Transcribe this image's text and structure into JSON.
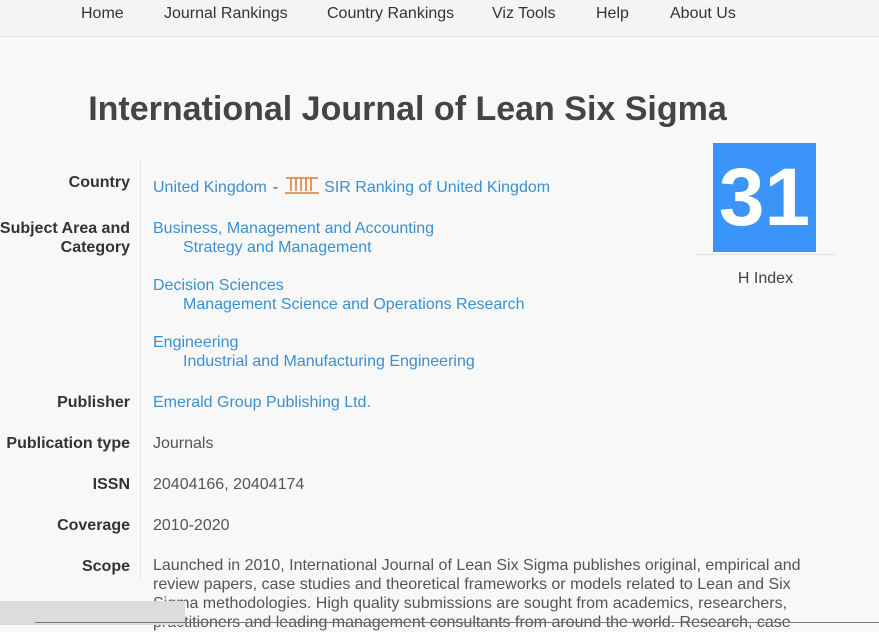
{
  "nav": {
    "items": [
      {
        "label": "Home"
      },
      {
        "label": "Journal Rankings"
      },
      {
        "label": "Country Rankings"
      },
      {
        "label": "Viz Tools"
      },
      {
        "label": "Help"
      },
      {
        "label": "About Us"
      }
    ]
  },
  "journal": {
    "title": "International Journal of Lean Six Sigma"
  },
  "country": {
    "label": "Country",
    "value": "United Kingdom",
    "separator": "-",
    "sir_link": "SIR Ranking of United Kingdom"
  },
  "subject": {
    "label_line1": "Subject Area and",
    "label_line2": "Category",
    "areas": [
      {
        "area": "Business, Management and Accounting",
        "category": "Strategy and Management"
      },
      {
        "area": "Decision Sciences",
        "category": "Management Science and Operations Research"
      },
      {
        "area": "Engineering",
        "category": "Industrial and Manufacturing Engineering"
      }
    ]
  },
  "publisher": {
    "label": "Publisher",
    "value": "Emerald Group Publishing Ltd."
  },
  "pubtype": {
    "label": "Publication type",
    "value": "Journals"
  },
  "issn": {
    "label": "ISSN",
    "value": "20404166, 20404174"
  },
  "coverage": {
    "label": "Coverage",
    "value": "2010-2020"
  },
  "scope": {
    "label": "Scope",
    "text": "Launched in 2010, International Journal of Lean Six Sigma publishes original, empirical and review papers, case studies and theoretical frameworks or models related to Lean and Six Sigma methodologies. High quality submissions are sought from academics, researchers, practitioners and leading management consultants from around the world. Research, case"
  },
  "hindex": {
    "value": "31",
    "label": "H Index"
  },
  "colors": {
    "accent": "#3b94f7",
    "link": "#3b8fd0",
    "sir_icon": "#e07b39"
  }
}
